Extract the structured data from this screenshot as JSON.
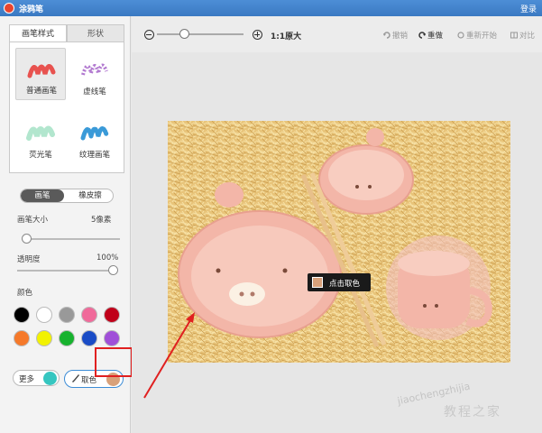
{
  "window": {
    "title": "涂鸦笔",
    "login_label": "登录"
  },
  "sidebar": {
    "tabs": [
      {
        "label": "画笔样式"
      },
      {
        "label": "形状"
      }
    ],
    "brushes": [
      {
        "label": "普通画笔",
        "color": "#e8524f"
      },
      {
        "label": "虚线笔",
        "color": "#b27ad0"
      },
      {
        "label": "荧光笔",
        "color": "#9fe0c2"
      },
      {
        "label": "纹理画笔",
        "color": "#3a9ad8"
      }
    ],
    "mode": {
      "pen_label": "画笔",
      "eraser_label": "橡皮擦"
    },
    "brush_size": {
      "label": "画笔大小",
      "value_text": "5像素",
      "value": 5
    },
    "opacity": {
      "label": "透明度",
      "value_text": "100%",
      "value": 1.0
    },
    "colors": {
      "label": "颜色",
      "palette": [
        "#000000",
        "#ffffff",
        "#999999",
        "#f06a9a",
        "#c0001a",
        "#f5792a",
        "#f2f200",
        "#17b22e",
        "#1a4cc6",
        "#a04fd8"
      ]
    },
    "more": {
      "label": "更多",
      "color": "#36c6c0"
    },
    "picker": {
      "label": "取色",
      "color": "#d8a17a"
    }
  },
  "toolbar": {
    "zoom": {
      "label": "1:1原大",
      "level": 0.3
    },
    "undo_label": "撤销",
    "redo_label": "重做",
    "restart_label": "重新开始",
    "compare_label": "对比"
  },
  "tooltip": {
    "label": "点击取色",
    "color": "#d8a17a"
  },
  "watermark": {
    "url": "jiaochengzhijia",
    "site": "教程之家"
  }
}
